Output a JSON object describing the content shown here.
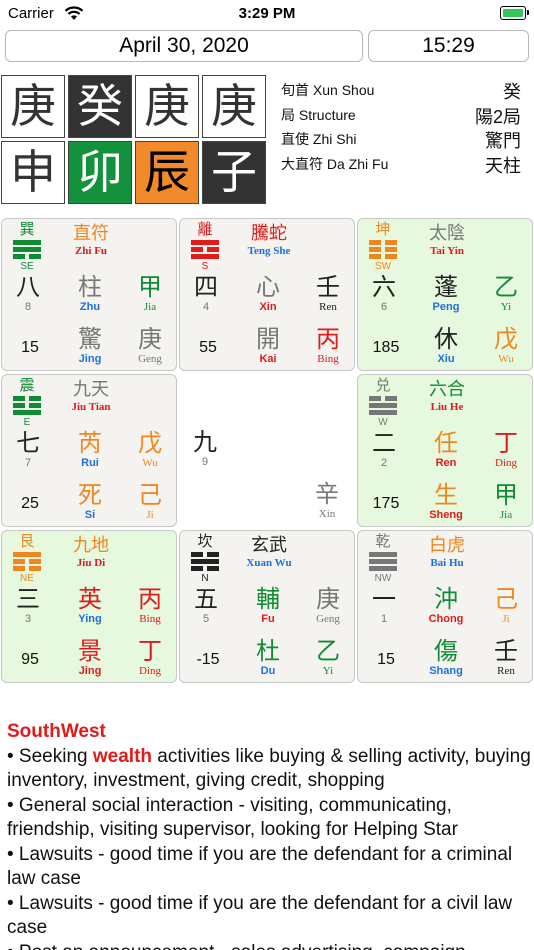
{
  "status": {
    "carrier": "Carrier",
    "time": "3:29 PM"
  },
  "header": {
    "date": "April 30, 2020",
    "time": "15:29"
  },
  "pillars": [
    {
      "char": "庚",
      "style": "white"
    },
    {
      "char": "癸",
      "style": "black"
    },
    {
      "char": "庚",
      "style": "white"
    },
    {
      "char": "庚",
      "style": "white"
    },
    {
      "char": "申",
      "style": "white"
    },
    {
      "char": "卯",
      "style": "green"
    },
    {
      "char": "辰",
      "style": "orange"
    },
    {
      "char": "子",
      "style": "black"
    }
  ],
  "info": [
    {
      "label": "旬首 Xun Shou",
      "value": "癸"
    },
    {
      "label": "局 Structure",
      "value": "陽2局"
    },
    {
      "label": "直使 Zhi Shi",
      "value": "驚門"
    },
    {
      "label": "大直符 Da Zhi Fu",
      "value": "天柱"
    }
  ],
  "palaces": {
    "se": {
      "trigram": "巽",
      "trigram_color": "#108c34",
      "dir": "SE",
      "god": "直符",
      "god_py": "Zhi Fu",
      "god_color": "#f0871e",
      "god_py_color": "#e11a1a",
      "e_z": "八",
      "e_p": "8",
      "star_z": "柱",
      "star_p": "Zhu",
      "star_color": "#777777",
      "star_p_color": "#1e6fe0",
      "s1_z": "甲",
      "s1_p": "Jia",
      "s1_color": "#108c34",
      "num": "15",
      "door_z": "驚",
      "door_p": "Jing",
      "door_color": "#777777",
      "door_p_color": "#1e6fe0",
      "s2_z": "庚",
      "s2_p": "Geng",
      "s2_color": "#777777"
    },
    "s": {
      "trigram": "離",
      "trigram_color": "#e11a1a",
      "dir": "S",
      "god": "騰蛇",
      "god_py": "Teng She",
      "god_color": "#e11a1a",
      "god_py_color": "#1e6fe0",
      "e_z": "四",
      "e_p": "4",
      "star_z": "心",
      "star_p": "Xin",
      "star_color": "#777777",
      "star_p_color": "#e11a1a",
      "s1_z": "壬",
      "s1_p": "Ren",
      "s1_color": "#222222",
      "num": "55",
      "door_z": "開",
      "door_p": "Kai",
      "door_color": "#777777",
      "door_p_color": "#e11a1a",
      "s2_z": "丙",
      "s2_p": "Bing",
      "s2_color": "#e11a1a"
    },
    "sw": {
      "trigram": "坤",
      "trigram_color": "#f0871e",
      "dir": "SW",
      "god": "太陰",
      "god_py": "Tai Yin",
      "god_color": "#777777",
      "god_py_color": "#e11a1a",
      "e_z": "六",
      "e_p": "6",
      "star_z": "蓬",
      "star_p": "Peng",
      "star_color": "#222222",
      "star_p_color": "#1e6fe0",
      "s1_z": "乙",
      "s1_p": "Yi",
      "s1_color": "#108c34",
      "num": "185",
      "door_z": "休",
      "door_p": "Xiu",
      "door_color": "#222222",
      "door_p_color": "#1e6fe0",
      "s2_z": "戊",
      "s2_p": "Wu",
      "s2_color": "#f0871e"
    },
    "e": {
      "trigram": "震",
      "trigram_color": "#108c34",
      "dir": "E",
      "god": "九天",
      "god_py": "Jiu Tian",
      "god_color": "#777777",
      "god_py_color": "#e11a1a",
      "e_z": "七",
      "e_p": "7",
      "star_z": "芮",
      "star_p": "Rui",
      "star_color": "#f0871e",
      "star_p_color": "#1e6fe0",
      "s1_z": "戊",
      "s1_p": "Wu",
      "s1_color": "#f0871e",
      "num": "25",
      "door_z": "死",
      "door_p": "Si",
      "door_color": "#f0871e",
      "door_p_color": "#1e6fe0",
      "s2_z": "己",
      "s2_p": "Ji",
      "s2_color": "#f0871e"
    },
    "c": {
      "e_z": "九",
      "e_p": "9",
      "s2_z": "辛",
      "s2_p": "Xin",
      "s2_color": "#777777"
    },
    "w": {
      "trigram": "兑",
      "trigram_color": "#777777",
      "dir": "W",
      "god": "六合",
      "god_py": "Liu He",
      "god_color": "#108c34",
      "god_py_color": "#e11a1a",
      "e_z": "二",
      "e_p": "2",
      "star_z": "任",
      "star_p": "Ren",
      "star_color": "#f0871e",
      "star_p_color": "#e11a1a",
      "s1_z": "丁",
      "s1_p": "Ding",
      "s1_color": "#e11a1a",
      "num": "175",
      "door_z": "生",
      "door_p": "Sheng",
      "door_color": "#f0871e",
      "door_p_color": "#e11a1a",
      "s2_z": "甲",
      "s2_p": "Jia",
      "s2_color": "#108c34"
    },
    "ne": {
      "trigram": "艮",
      "trigram_color": "#f0871e",
      "dir": "NE",
      "god": "九地",
      "god_py": "Jiu Di",
      "god_color": "#f0871e",
      "god_py_color": "#e11a1a",
      "e_z": "三",
      "e_p": "3",
      "star_z": "英",
      "star_p": "Ying",
      "star_color": "#e11a1a",
      "star_p_color": "#1e6fe0",
      "s1_z": "丙",
      "s1_p": "Bing",
      "s1_color": "#e11a1a",
      "num": "95",
      "door_z": "景",
      "door_p": "Jing",
      "door_color": "#e11a1a",
      "door_p_color": "#e11a1a",
      "s2_z": "丁",
      "s2_p": "Ding",
      "s2_color": "#e11a1a"
    },
    "n": {
      "trigram": "坎",
      "trigram_color": "#222222",
      "dir": "N",
      "god": "玄武",
      "god_py": "Xuan Wu",
      "god_color": "#222222",
      "god_py_color": "#1e6fe0",
      "e_z": "五",
      "e_p": "5",
      "star_z": "輔",
      "star_p": "Fu",
      "star_color": "#108c34",
      "star_p_color": "#e11a1a",
      "s1_z": "庚",
      "s1_p": "Geng",
      "s1_color": "#777777",
      "num": "-15",
      "door_z": "杜",
      "door_p": "Du",
      "door_color": "#108c34",
      "door_p_color": "#1e6fe0",
      "s2_z": "乙",
      "s2_p": "Yi",
      "s2_color": "#108c34"
    },
    "nw": {
      "trigram": "乾",
      "trigram_color": "#777777",
      "dir": "NW",
      "god": "白虎",
      "god_py": "Bai Hu",
      "god_color": "#f0871e",
      "god_py_color": "#1e6fe0",
      "e_z": "一",
      "e_p": "1",
      "star_z": "沖",
      "star_p": "Chong",
      "star_color": "#108c34",
      "star_p_color": "#e11a1a",
      "s1_z": "己",
      "s1_p": "Ji",
      "s1_color": "#f0871e",
      "num": "15",
      "door_z": "傷",
      "door_p": "Shang",
      "door_color": "#108c34",
      "door_p_color": "#1e6fe0",
      "s2_z": "壬",
      "s2_p": "Ren",
      "s2_color": "#222222"
    }
  },
  "description": {
    "title": "SouthWest",
    "line1_pre": "• Seeking ",
    "line1_hl": "wealth",
    "line1_post": " activities like buying & selling activity, buying inventory, investment, giving credit, shopping",
    "line2": "• General social interaction - visiting, communicating, friendship, visiting supervisor, looking for Helping Star",
    "line3": "• Lawsuits - good time if you are the defendant for a criminal law case",
    "line4": "• Lawsuits - good time if you are the defendant for a civil law case",
    "line5": "• Post an announcement - sales advertising, campaign"
  },
  "colors": {
    "accent_red": "#e11a1a",
    "green_palace_bg": "#e6f8dd",
    "gray_palace_bg": "#f4f3ef"
  }
}
